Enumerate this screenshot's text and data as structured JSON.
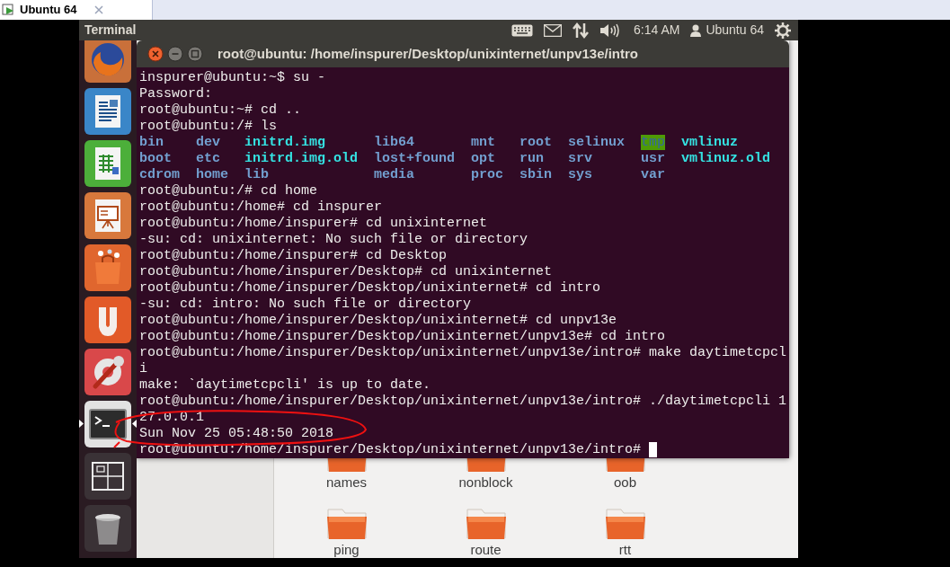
{
  "vm_tab": {
    "title": "Ubuntu 64"
  },
  "top_panel": {
    "app_name": "Terminal",
    "clock": "6:14 AM",
    "user": "Ubuntu 64"
  },
  "launcher": {
    "items": [
      {
        "kind": "browser",
        "active": false
      },
      {
        "kind": "writer",
        "active": false
      },
      {
        "kind": "calc",
        "active": false
      },
      {
        "kind": "impress",
        "active": false
      },
      {
        "kind": "store",
        "active": false
      },
      {
        "kind": "cloud",
        "active": false
      },
      {
        "kind": "settings",
        "active": false
      },
      {
        "kind": "terminal",
        "active": true
      },
      {
        "kind": "workspaces",
        "active": false
      },
      {
        "kind": "trash",
        "active": false
      }
    ]
  },
  "terminal": {
    "title": "root@ubuntu: /home/inspurer/Desktop/unixinternet/unpv13e/intro",
    "lines": [
      {
        "kind": "text",
        "text": "inspurer@ubuntu:~$ su -"
      },
      {
        "kind": "text",
        "text": "Password:"
      },
      {
        "kind": "text",
        "text": "root@ubuntu:~# cd .."
      },
      {
        "kind": "text",
        "text": "root@ubuntu:/# ls"
      },
      {
        "kind": "listing",
        "entries": [
          {
            "name": "bin",
            "kind": "dir"
          },
          {
            "name": "dev",
            "kind": "dir"
          },
          {
            "name": "initrd.img",
            "kind": "link"
          },
          {
            "name": "lib64",
            "kind": "dir"
          },
          {
            "name": "mnt",
            "kind": "dir"
          },
          {
            "name": "root",
            "kind": "dir"
          },
          {
            "name": "selinux",
            "kind": "dir"
          },
          {
            "name": "tmp",
            "kind": "sticky"
          },
          {
            "name": "vmlinuz",
            "kind": "link"
          }
        ]
      },
      {
        "kind": "listing",
        "entries": [
          {
            "name": "boot",
            "kind": "dir"
          },
          {
            "name": "etc",
            "kind": "dir"
          },
          {
            "name": "initrd.img.old",
            "kind": "link"
          },
          {
            "name": "lost+found",
            "kind": "dir"
          },
          {
            "name": "opt",
            "kind": "dir"
          },
          {
            "name": "run",
            "kind": "dir"
          },
          {
            "name": "srv",
            "kind": "dir"
          },
          {
            "name": "usr",
            "kind": "dir"
          },
          {
            "name": "vmlinuz.old",
            "kind": "link"
          }
        ]
      },
      {
        "kind": "listing",
        "entries": [
          {
            "name": "cdrom",
            "kind": "dir"
          },
          {
            "name": "home",
            "kind": "dir"
          },
          {
            "name": "lib",
            "kind": "dir"
          },
          {
            "name": "media",
            "kind": "dir"
          },
          {
            "name": "proc",
            "kind": "dir"
          },
          {
            "name": "sbin",
            "kind": "dir"
          },
          {
            "name": "sys",
            "kind": "dir"
          },
          {
            "name": "var",
            "kind": "dir"
          }
        ]
      },
      {
        "kind": "text",
        "text": "root@ubuntu:/# cd home"
      },
      {
        "kind": "text",
        "text": "root@ubuntu:/home# cd inspurer"
      },
      {
        "kind": "text",
        "text": "root@ubuntu:/home/inspurer# cd unixinternet"
      },
      {
        "kind": "text",
        "text": "-su: cd: unixinternet: No such file or directory"
      },
      {
        "kind": "text",
        "text": "root@ubuntu:/home/inspurer# cd Desktop"
      },
      {
        "kind": "text",
        "text": "root@ubuntu:/home/inspurer/Desktop# cd unixinternet"
      },
      {
        "kind": "text",
        "text": "root@ubuntu:/home/inspurer/Desktop/unixinternet# cd intro"
      },
      {
        "kind": "text",
        "text": "-su: cd: intro: No such file or directory"
      },
      {
        "kind": "text",
        "text": "root@ubuntu:/home/inspurer/Desktop/unixinternet# cd unpv13e"
      },
      {
        "kind": "text",
        "text": "root@ubuntu:/home/inspurer/Desktop/unixinternet/unpv13e# cd intro"
      },
      {
        "kind": "text",
        "text": "root@ubuntu:/home/inspurer/Desktop/unixinternet/unpv13e/intro# make daytimetcpcl"
      },
      {
        "kind": "text",
        "text": "i"
      },
      {
        "kind": "text",
        "text": "make: `daytimetcpcli' is up to date."
      },
      {
        "kind": "text",
        "text": "root@ubuntu:/home/inspurer/Desktop/unixinternet/unpv13e/intro# ./daytimetcpcli 1"
      },
      {
        "kind": "text",
        "text": "27.0.0.1"
      },
      {
        "kind": "text",
        "text": "Sun Nov 25 05:48:50 2018"
      },
      {
        "kind": "prompt",
        "text": "root@ubuntu:/home/inspurer/Desktop/unixinternet/unpv13e/intro#"
      }
    ]
  },
  "file_manager": {
    "folders": [
      {
        "name": "names"
      },
      {
        "name": "nonblock"
      },
      {
        "name": "oob"
      },
      {
        "name": "ping"
      },
      {
        "name": "route"
      },
      {
        "name": "rtt"
      }
    ]
  }
}
